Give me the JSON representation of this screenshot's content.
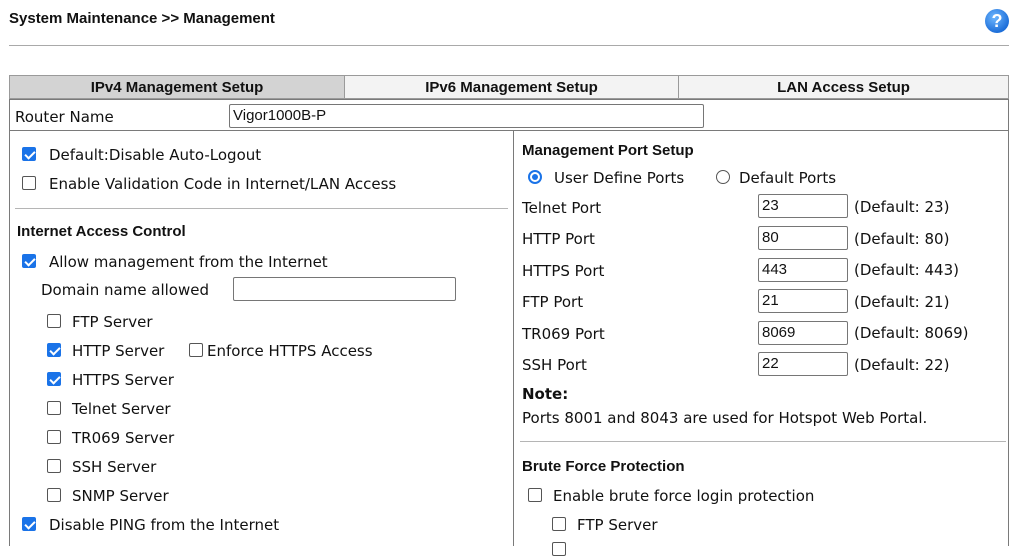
{
  "header": {
    "title": "System Maintenance >> Management",
    "help_icon": "?"
  },
  "tabs": [
    {
      "label": "IPv4 Management Setup",
      "active": true
    },
    {
      "label": "IPv6 Management Setup",
      "active": false
    },
    {
      "label": "LAN Access Setup",
      "active": false
    }
  ],
  "router": {
    "label": "Router Name",
    "value": "Vigor1000B-P"
  },
  "left": {
    "auto_logout": {
      "label": "Default:Disable Auto-Logout",
      "checked": true
    },
    "validation": {
      "label": "Enable Validation Code in Internet/LAN Access",
      "checked": false
    },
    "iac": {
      "title": "Internet Access Control",
      "allow": {
        "label": "Allow management from the Internet",
        "checked": true
      },
      "domain": {
        "label": "Domain name allowed",
        "value": ""
      },
      "ftp": {
        "label": "FTP Server",
        "checked": false
      },
      "http": {
        "label": "HTTP Server",
        "checked": true
      },
      "enforce": {
        "label": "Enforce HTTPS Access",
        "checked": false
      },
      "https": {
        "label": "HTTPS Server",
        "checked": true
      },
      "telnet": {
        "label": "Telnet Server",
        "checked": false
      },
      "tr069": {
        "label": "TR069 Server",
        "checked": false
      },
      "ssh": {
        "label": "SSH Server",
        "checked": false
      },
      "snmp": {
        "label": "SNMP Server",
        "checked": false
      }
    },
    "ping": {
      "label": "Disable PING from the Internet",
      "checked": true
    }
  },
  "right": {
    "mps": {
      "title": "Management Port Setup",
      "user_define": "User Define Ports",
      "default_ports": "Default Ports",
      "selected": "user_define",
      "telnet": {
        "label": "Telnet Port",
        "value": "23",
        "default": "(Default: 23)"
      },
      "http": {
        "label": "HTTP Port",
        "value": "80",
        "default": "(Default: 80)"
      },
      "https": {
        "label": "HTTPS Port",
        "value": "443",
        "default": "(Default: 443)"
      },
      "ftp": {
        "label": "FTP Port",
        "value": "21",
        "default": "(Default: 21)"
      },
      "tr069": {
        "label": "TR069 Port",
        "value": "8069",
        "default": "(Default: 8069)"
      },
      "ssh": {
        "label": "SSH Port",
        "value": "22",
        "default": "(Default: 22)"
      }
    },
    "note": {
      "title": "Note:",
      "text": "Ports 8001 and 8043 are used for Hotspot Web Portal."
    },
    "bfp": {
      "title": "Brute Force Protection",
      "enable": {
        "label": "Enable brute force login protection",
        "checked": false
      },
      "ftp": {
        "label": "FTP Server",
        "checked": false
      }
    }
  },
  "colors": {
    "accent": "#1a73e8",
    "tab_active": "#d3d3d3",
    "tab_inactive": "#f3f3f3",
    "border": "#7a7a7a"
  }
}
